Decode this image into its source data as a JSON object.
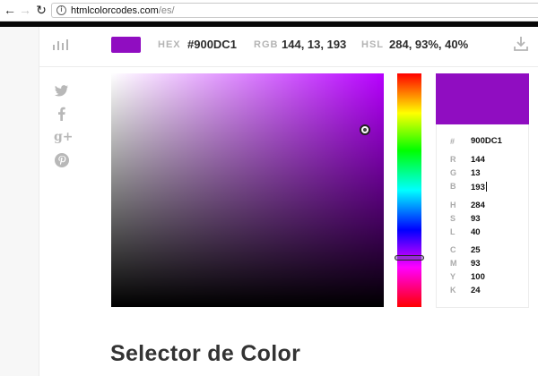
{
  "browser": {
    "url_domain": "htmlcolorcodes.com",
    "url_path": "/es/"
  },
  "header": {
    "hex_label": "HEX",
    "hex_value": "#900DC1",
    "rgb_label": "RGB",
    "rgb_value": "144, 13, 193",
    "hsl_label": "HSL",
    "hsl_value": "284, 93%, 40%"
  },
  "colors": {
    "selected": "#900DC1",
    "hue_base": "#B700FF"
  },
  "icons": {
    "stats": "bar-chart-icon",
    "download": "download-icon",
    "social": [
      "twitter-icon",
      "facebook-icon",
      "google-plus-icon",
      "pinterest-icon"
    ]
  },
  "panel": {
    "hex": {
      "key": "#",
      "value": "900DC1"
    },
    "r": {
      "key": "R",
      "value": "144"
    },
    "g": {
      "key": "G",
      "value": "13"
    },
    "b": {
      "key": "B",
      "value": "193"
    },
    "h": {
      "key": "H",
      "value": "284"
    },
    "s": {
      "key": "S",
      "value": "93"
    },
    "l": {
      "key": "L",
      "value": "40"
    },
    "c": {
      "key": "C",
      "value": "25"
    },
    "m": {
      "key": "M",
      "value": "93"
    },
    "y": {
      "key": "Y",
      "value": "100"
    },
    "k": {
      "key": "K",
      "value": "24"
    }
  },
  "page_title": "Selector de Color"
}
